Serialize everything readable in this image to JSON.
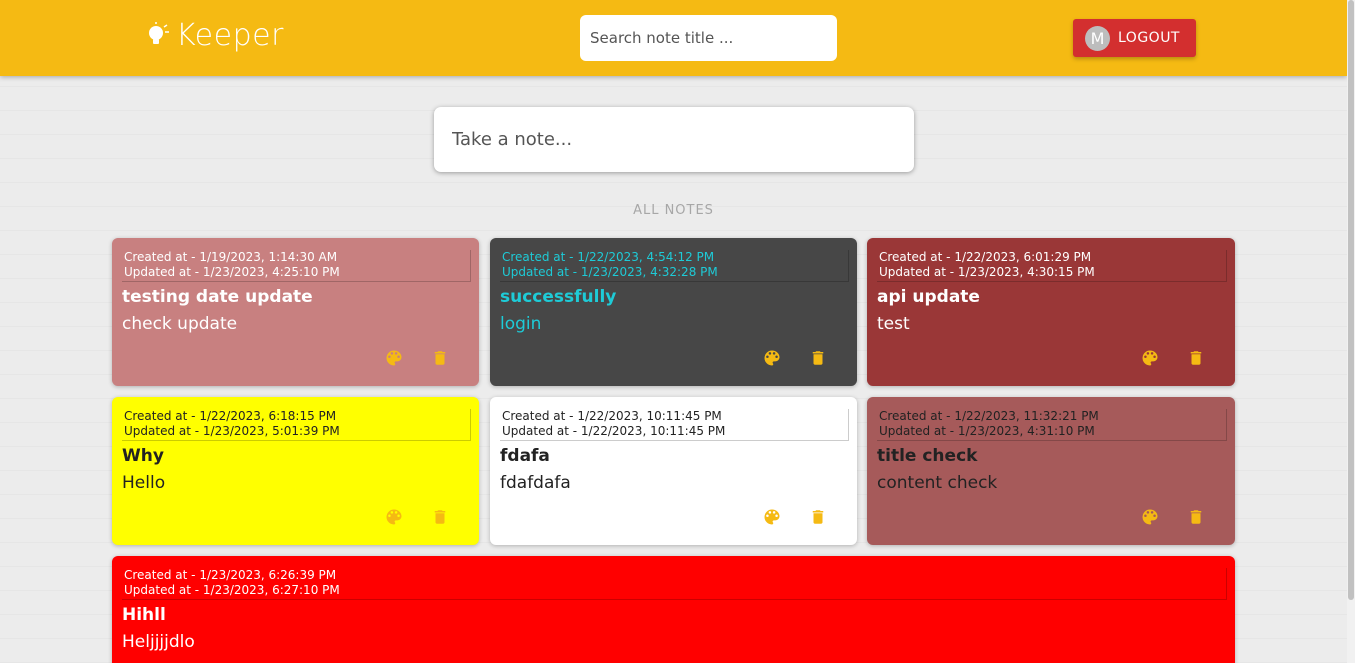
{
  "header": {
    "app_name": "Keeper",
    "search_placeholder": "Search note title ...",
    "avatar_initial": "M",
    "logout_label": "LOGOUT"
  },
  "composer": {
    "placeholder": "Take a note..."
  },
  "section_title": "ALL NOTES",
  "colors": {
    "accent": "#f5ba13",
    "logout": "#d32f2f"
  },
  "notes": [
    {
      "created": "Created at - 1/19/2023, 1:14:30 AM",
      "updated": "Updated at - 1/23/2023, 4:25:10 PM",
      "title": "testing date update",
      "content": "check update",
      "bg": "#c88080",
      "text_color": "#ffffff"
    },
    {
      "created": "Created at - 1/22/2023, 4:54:12 PM",
      "updated": "Updated at - 1/23/2023, 4:32:28 PM",
      "title": "successfully",
      "content": "login",
      "bg": "#474747",
      "text_color": "#1ecbd7"
    },
    {
      "created": "Created at - 1/22/2023, 6:01:29 PM",
      "updated": "Updated at - 1/23/2023, 4:30:15 PM",
      "title": "api update",
      "content": "test",
      "bg": "#9a3737",
      "text_color": "#ffffff"
    },
    {
      "created": "Created at - 1/22/2023, 6:18:15 PM",
      "updated": "Updated at - 1/23/2023, 5:01:39 PM",
      "title": "Why",
      "content": "Hello",
      "bg": "#ffff00",
      "text_color": "#222222"
    },
    {
      "created": "Created at - 1/22/2023, 10:11:45 PM",
      "updated": "Updated at - 1/22/2023, 10:11:45 PM",
      "title": "fdafa",
      "content": "fdafdafa",
      "bg": "#ffffff",
      "text_color": "#222222"
    },
    {
      "created": "Created at - 1/22/2023, 11:32:21 PM",
      "updated": "Updated at - 1/23/2023, 4:31:10 PM",
      "title": "title check",
      "content": "content check",
      "bg": "#a65a5a",
      "text_color": "#222222"
    },
    {
      "created": "Created at - 1/23/2023, 6:26:39 PM",
      "updated": "Updated at - 1/23/2023, 6:27:10 PM",
      "title": "Hihll",
      "content": "Heljjjjdlo",
      "bg": "#ff0000",
      "text_color": "#ffffff"
    }
  ]
}
